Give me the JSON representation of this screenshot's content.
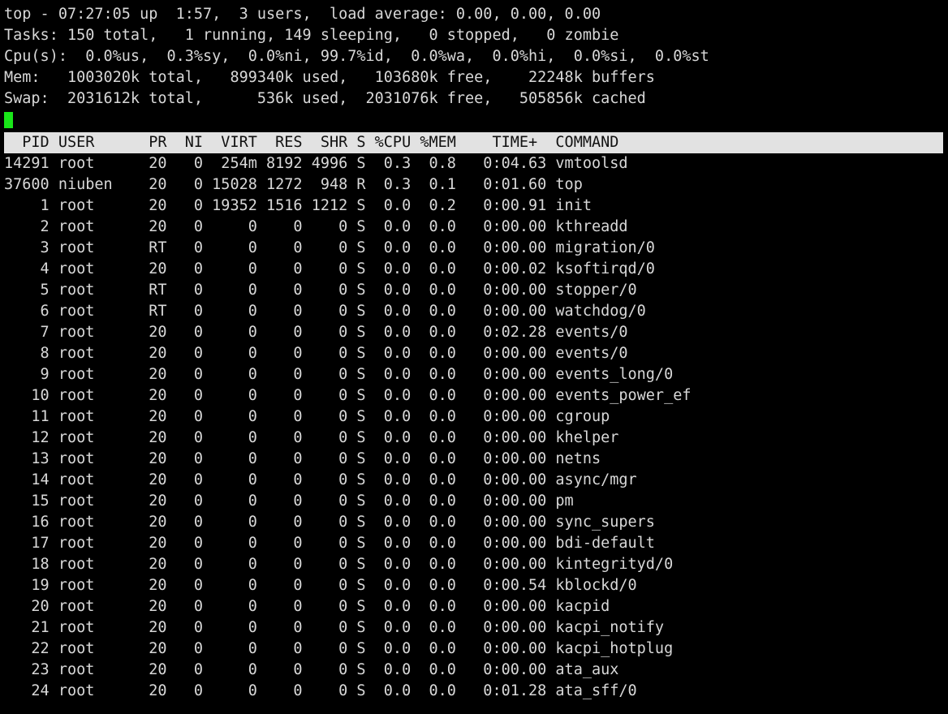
{
  "terminal": {
    "title": "top",
    "background_color": "#000000",
    "foreground_color": "#d8d8d8",
    "cursor_color": "#19e619",
    "header_bg_color": "#e2e2e2",
    "header_fg_color": "#111111"
  },
  "summary": {
    "uptime_line": "top - 07:27:05 up  1:57,  3 users,  load average: 0.00, 0.00, 0.00",
    "tasks_line": "Tasks: 150 total,   1 running, 149 sleeping,   0 stopped,   0 zombie",
    "cpu_line": "Cpu(s):  0.0%us,  0.3%sy,  0.0%ni, 99.7%id,  0.0%wa,  0.0%hi,  0.0%si,  0.0%st",
    "mem_line": "Mem:   1003020k total,   899340k used,   103680k free,    22248k buffers",
    "swap_line": "Swap:  2031612k total,      536k used,  2031076k free,   505856k cached",
    "fields": {
      "time": "07:27:05",
      "uptime": "1:57",
      "users": "3",
      "load_average": [
        "0.00",
        "0.00",
        "0.00"
      ],
      "tasks_total": "150",
      "tasks_running": "1",
      "tasks_sleeping": "149",
      "tasks_stopped": "0",
      "tasks_zombie": "0",
      "cpu_us": "0.0",
      "cpu_sy": "0.3",
      "cpu_ni": "0.0",
      "cpu_id": "99.7",
      "cpu_wa": "0.0",
      "cpu_hi": "0.0",
      "cpu_si": "0.0",
      "cpu_st": "0.0",
      "mem_total": "1003020k",
      "mem_used": "899340k",
      "mem_free": "103680k",
      "mem_buffers": "22248k",
      "swap_total": "2031612k",
      "swap_used": "536k",
      "swap_free": "2031076k",
      "swap_cached": "505856k"
    }
  },
  "cursor": {
    "visible": true
  },
  "process_table": {
    "header_line": "  PID USER      PR  NI  VIRT  RES  SHR S %CPU %MEM    TIME+  COMMAND                      ",
    "columns": [
      "PID",
      "USER",
      "PR",
      "NI",
      "VIRT",
      "RES",
      "SHR",
      "S",
      "%CPU",
      "%MEM",
      "TIME+",
      "COMMAND"
    ],
    "rows": [
      {
        "line": "14291 root      20   0  254m 8192 4996 S  0.3  0.8   0:04.63 vmtoolsd",
        "pid": "14291",
        "user": "root",
        "pr": "20",
        "ni": "0",
        "virt": "254m",
        "res": "8192",
        "shr": "4996",
        "s": "S",
        "cpu": "0.3",
        "mem": "0.8",
        "time": "0:04.63",
        "command": "vmtoolsd"
      },
      {
        "line": "37600 niuben    20   0 15028 1272  948 R  0.3  0.1   0:01.60 top",
        "pid": "37600",
        "user": "niuben",
        "pr": "20",
        "ni": "0",
        "virt": "15028",
        "res": "1272",
        "shr": "948",
        "s": "R",
        "cpu": "0.3",
        "mem": "0.1",
        "time": "0:01.60",
        "command": "top"
      },
      {
        "line": "    1 root      20   0 19352 1516 1212 S  0.0  0.2   0:00.91 init",
        "pid": "1",
        "user": "root",
        "pr": "20",
        "ni": "0",
        "virt": "19352",
        "res": "1516",
        "shr": "1212",
        "s": "S",
        "cpu": "0.0",
        "mem": "0.2",
        "time": "0:00.91",
        "command": "init"
      },
      {
        "line": "    2 root      20   0     0    0    0 S  0.0  0.0   0:00.00 kthreadd",
        "pid": "2",
        "user": "root",
        "pr": "20",
        "ni": "0",
        "virt": "0",
        "res": "0",
        "shr": "0",
        "s": "S",
        "cpu": "0.0",
        "mem": "0.0",
        "time": "0:00.00",
        "command": "kthreadd"
      },
      {
        "line": "    3 root      RT   0     0    0    0 S  0.0  0.0   0:00.00 migration/0",
        "pid": "3",
        "user": "root",
        "pr": "RT",
        "ni": "0",
        "virt": "0",
        "res": "0",
        "shr": "0",
        "s": "S",
        "cpu": "0.0",
        "mem": "0.0",
        "time": "0:00.00",
        "command": "migration/0"
      },
      {
        "line": "    4 root      20   0     0    0    0 S  0.0  0.0   0:00.02 ksoftirqd/0",
        "pid": "4",
        "user": "root",
        "pr": "20",
        "ni": "0",
        "virt": "0",
        "res": "0",
        "shr": "0",
        "s": "S",
        "cpu": "0.0",
        "mem": "0.0",
        "time": "0:00.02",
        "command": "ksoftirqd/0"
      },
      {
        "line": "    5 root      RT   0     0    0    0 S  0.0  0.0   0:00.00 stopper/0",
        "pid": "5",
        "user": "root",
        "pr": "RT",
        "ni": "0",
        "virt": "0",
        "res": "0",
        "shr": "0",
        "s": "S",
        "cpu": "0.0",
        "mem": "0.0",
        "time": "0:00.00",
        "command": "stopper/0"
      },
      {
        "line": "    6 root      RT   0     0    0    0 S  0.0  0.0   0:00.00 watchdog/0",
        "pid": "6",
        "user": "root",
        "pr": "RT",
        "ni": "0",
        "virt": "0",
        "res": "0",
        "shr": "0",
        "s": "S",
        "cpu": "0.0",
        "mem": "0.0",
        "time": "0:00.00",
        "command": "watchdog/0"
      },
      {
        "line": "    7 root      20   0     0    0    0 S  0.0  0.0   0:02.28 events/0",
        "pid": "7",
        "user": "root",
        "pr": "20",
        "ni": "0",
        "virt": "0",
        "res": "0",
        "shr": "0",
        "s": "S",
        "cpu": "0.0",
        "mem": "0.0",
        "time": "0:02.28",
        "command": "events/0"
      },
      {
        "line": "    8 root      20   0     0    0    0 S  0.0  0.0   0:00.00 events/0",
        "pid": "8",
        "user": "root",
        "pr": "20",
        "ni": "0",
        "virt": "0",
        "res": "0",
        "shr": "0",
        "s": "S",
        "cpu": "0.0",
        "mem": "0.0",
        "time": "0:00.00",
        "command": "events/0"
      },
      {
        "line": "    9 root      20   0     0    0    0 S  0.0  0.0   0:00.00 events_long/0",
        "pid": "9",
        "user": "root",
        "pr": "20",
        "ni": "0",
        "virt": "0",
        "res": "0",
        "shr": "0",
        "s": "S",
        "cpu": "0.0",
        "mem": "0.0",
        "time": "0:00.00",
        "command": "events_long/0"
      },
      {
        "line": "   10 root      20   0     0    0    0 S  0.0  0.0   0:00.00 events_power_ef",
        "pid": "10",
        "user": "root",
        "pr": "20",
        "ni": "0",
        "virt": "0",
        "res": "0",
        "shr": "0",
        "s": "S",
        "cpu": "0.0",
        "mem": "0.0",
        "time": "0:00.00",
        "command": "events_power_ef"
      },
      {
        "line": "   11 root      20   0     0    0    0 S  0.0  0.0   0:00.00 cgroup",
        "pid": "11",
        "user": "root",
        "pr": "20",
        "ni": "0",
        "virt": "0",
        "res": "0",
        "shr": "0",
        "s": "S",
        "cpu": "0.0",
        "mem": "0.0",
        "time": "0:00.00",
        "command": "cgroup"
      },
      {
        "line": "   12 root      20   0     0    0    0 S  0.0  0.0   0:00.00 khelper",
        "pid": "12",
        "user": "root",
        "pr": "20",
        "ni": "0",
        "virt": "0",
        "res": "0",
        "shr": "0",
        "s": "S",
        "cpu": "0.0",
        "mem": "0.0",
        "time": "0:00.00",
        "command": "khelper"
      },
      {
        "line": "   13 root      20   0     0    0    0 S  0.0  0.0   0:00.00 netns",
        "pid": "13",
        "user": "root",
        "pr": "20",
        "ni": "0",
        "virt": "0",
        "res": "0",
        "shr": "0",
        "s": "S",
        "cpu": "0.0",
        "mem": "0.0",
        "time": "0:00.00",
        "command": "netns"
      },
      {
        "line": "   14 root      20   0     0    0    0 S  0.0  0.0   0:00.00 async/mgr",
        "pid": "14",
        "user": "root",
        "pr": "20",
        "ni": "0",
        "virt": "0",
        "res": "0",
        "shr": "0",
        "s": "S",
        "cpu": "0.0",
        "mem": "0.0",
        "time": "0:00.00",
        "command": "async/mgr"
      },
      {
        "line": "   15 root      20   0     0    0    0 S  0.0  0.0   0:00.00 pm",
        "pid": "15",
        "user": "root",
        "pr": "20",
        "ni": "0",
        "virt": "0",
        "res": "0",
        "shr": "0",
        "s": "S",
        "cpu": "0.0",
        "mem": "0.0",
        "time": "0:00.00",
        "command": "pm"
      },
      {
        "line": "   16 root      20   0     0    0    0 S  0.0  0.0   0:00.00 sync_supers",
        "pid": "16",
        "user": "root",
        "pr": "20",
        "ni": "0",
        "virt": "0",
        "res": "0",
        "shr": "0",
        "s": "S",
        "cpu": "0.0",
        "mem": "0.0",
        "time": "0:00.00",
        "command": "sync_supers"
      },
      {
        "line": "   17 root      20   0     0    0    0 S  0.0  0.0   0:00.00 bdi-default",
        "pid": "17",
        "user": "root",
        "pr": "20",
        "ni": "0",
        "virt": "0",
        "res": "0",
        "shr": "0",
        "s": "S",
        "cpu": "0.0",
        "mem": "0.0",
        "time": "0:00.00",
        "command": "bdi-default"
      },
      {
        "line": "   18 root      20   0     0    0    0 S  0.0  0.0   0:00.00 kintegrityd/0",
        "pid": "18",
        "user": "root",
        "pr": "20",
        "ni": "0",
        "virt": "0",
        "res": "0",
        "shr": "0",
        "s": "S",
        "cpu": "0.0",
        "mem": "0.0",
        "time": "0:00.00",
        "command": "kintegrityd/0"
      },
      {
        "line": "   19 root      20   0     0    0    0 S  0.0  0.0   0:00.54 kblockd/0",
        "pid": "19",
        "user": "root",
        "pr": "20",
        "ni": "0",
        "virt": "0",
        "res": "0",
        "shr": "0",
        "s": "S",
        "cpu": "0.0",
        "mem": "0.0",
        "time": "0:00.54",
        "command": "kblockd/0"
      },
      {
        "line": "   20 root      20   0     0    0    0 S  0.0  0.0   0:00.00 kacpid",
        "pid": "20",
        "user": "root",
        "pr": "20",
        "ni": "0",
        "virt": "0",
        "res": "0",
        "shr": "0",
        "s": "S",
        "cpu": "0.0",
        "mem": "0.0",
        "time": "0:00.00",
        "command": "kacpid"
      },
      {
        "line": "   21 root      20   0     0    0    0 S  0.0  0.0   0:00.00 kacpi_notify",
        "pid": "21",
        "user": "root",
        "pr": "20",
        "ni": "0",
        "virt": "0",
        "res": "0",
        "shr": "0",
        "s": "S",
        "cpu": "0.0",
        "mem": "0.0",
        "time": "0:00.00",
        "command": "kacpi_notify"
      },
      {
        "line": "   22 root      20   0     0    0    0 S  0.0  0.0   0:00.00 kacpi_hotplug",
        "pid": "22",
        "user": "root",
        "pr": "20",
        "ni": "0",
        "virt": "0",
        "res": "0",
        "shr": "0",
        "s": "S",
        "cpu": "0.0",
        "mem": "0.0",
        "time": "0:00.00",
        "command": "kacpi_hotplug"
      },
      {
        "line": "   23 root      20   0     0    0    0 S  0.0  0.0   0:00.00 ata_aux",
        "pid": "23",
        "user": "root",
        "pr": "20",
        "ni": "0",
        "virt": "0",
        "res": "0",
        "shr": "0",
        "s": "S",
        "cpu": "0.0",
        "mem": "0.0",
        "time": "0:00.00",
        "command": "ata_aux"
      },
      {
        "line": "   24 root      20   0     0    0    0 S  0.0  0.0   0:01.28 ata_sff/0",
        "pid": "24",
        "user": "root",
        "pr": "20",
        "ni": "0",
        "virt": "0",
        "res": "0",
        "shr": "0",
        "s": "S",
        "cpu": "0.0",
        "mem": "0.0",
        "time": "0:01.28",
        "command": "ata_sff/0"
      }
    ]
  }
}
